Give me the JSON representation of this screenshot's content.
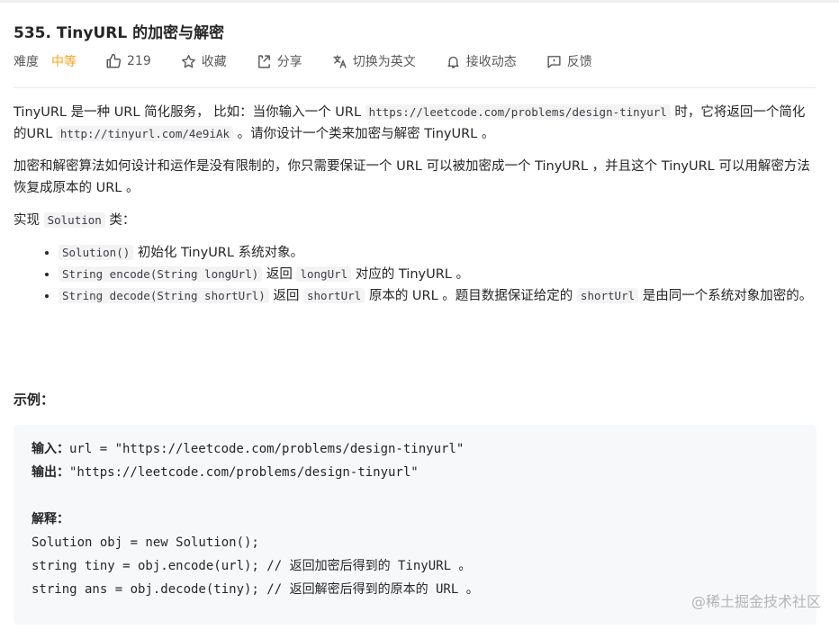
{
  "problem": {
    "title": "535. TinyURL 的加密与解密",
    "difficulty_label": "难度",
    "difficulty": "中等",
    "likes": "219",
    "actions": {
      "favorite": "收藏",
      "share": "分享",
      "switch_lang": "切换为英文",
      "subscribe": "接收动态",
      "feedback": "反馈"
    }
  },
  "description": {
    "p1_a": "TinyURL 是一种 URL 简化服务， 比如：当你输入一个 URL ",
    "p1_code1": "https://leetcode.com/problems/design-tinyurl",
    "p1_b": " 时，它将返回一个简化的URL ",
    "p1_code2": "http://tinyurl.com/4e9iAk",
    "p1_c": " 。请你设计一个类来加密与解密 TinyURL 。",
    "p2": "加密和解密算法如何设计和运作是没有限制的，你只需要保证一个 URL 可以被加密成一个 TinyURL ，并且这个 TinyURL 可以用解密方法恢复成原本的 URL 。",
    "p3_a": "实现 ",
    "p3_code": "Solution",
    "p3_b": " 类：",
    "bullets": [
      {
        "code": "Solution()",
        "text": " 初始化 TinyURL 系统对象。"
      },
      {
        "code": "String encode(String longUrl)",
        "text_a": " 返回 ",
        "code2": "longUrl",
        "text_b": " 对应的 TinyURL 。"
      },
      {
        "code": "String decode(String shortUrl)",
        "text_a": " 返回 ",
        "code2": "shortUrl",
        "text_b": " 原本的 URL 。题目数据保证给定的 ",
        "code3": "shortUrl",
        "text_c": " 是由同一个系统对象加密的。"
      }
    ]
  },
  "example": {
    "heading": "示例：",
    "input_label": "输入：",
    "input_value": "url = \"https://leetcode.com/problems/design-tinyurl\"",
    "output_label": "输出：",
    "output_value": "\"https://leetcode.com/problems/design-tinyurl\"",
    "explain_label": "解释：",
    "code_lines": [
      "Solution obj = new Solution();",
      "string tiny = obj.encode(url); // 返回加密后得到的 TinyURL 。",
      "string ans = obj.decode(tiny); // 返回解密后得到的原本的 URL 。"
    ]
  },
  "watermark": "@稀土掘金技术社区",
  "colors": {
    "difficulty": "#ffa116",
    "code_bg": "#f3f3f4",
    "pre_bg": "#f7f8fa"
  }
}
